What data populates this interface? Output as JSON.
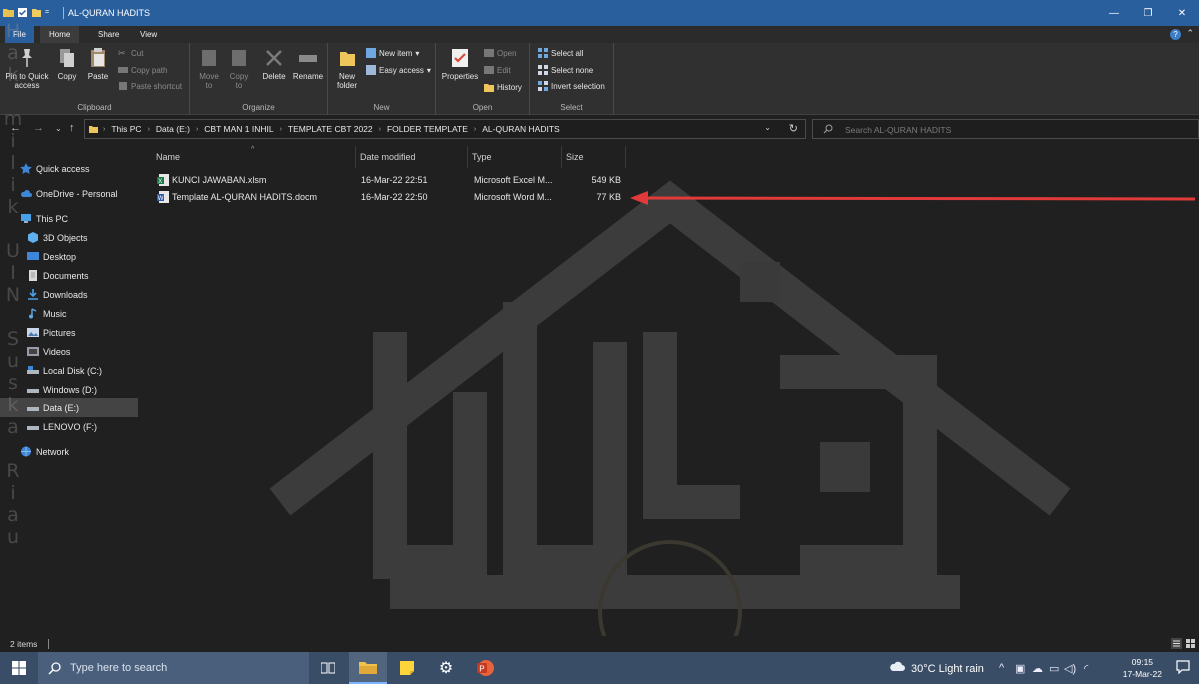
{
  "window": {
    "title": "AL-QURAN HADITS",
    "controls": {
      "minimize": "—",
      "restore": "❐",
      "close": "✕"
    }
  },
  "ribbon_tabs": [
    "File",
    "Home",
    "Share",
    "View"
  ],
  "ribbon": {
    "clipboard": {
      "label": "Clipboard",
      "pin": "Pin to Quick access",
      "copy": "Copy",
      "paste": "Paste",
      "cut": "Cut",
      "copy_path": "Copy path",
      "paste_shortcut": "Paste shortcut"
    },
    "organize": {
      "label": "Organize",
      "move_to": "Move to",
      "copy_to": "Copy to",
      "delete": "Delete",
      "rename": "Rename"
    },
    "new": {
      "label": "New",
      "new_folder": "New folder",
      "new_item": "New item",
      "easy_access": "Easy access"
    },
    "open": {
      "label": "Open",
      "properties": "Properties",
      "open": "Open",
      "edit": "Edit",
      "history": "History"
    },
    "select": {
      "label": "Select",
      "select_all": "Select all",
      "select_none": "Select none",
      "invert": "Invert selection"
    }
  },
  "breadcrumbs": [
    "This PC",
    "Data (E:)",
    "CBT MAN 1 INHIL",
    "TEMPLATE CBT 2022",
    "FOLDER TEMPLATE",
    "AL-QURAN HADITS"
  ],
  "search": {
    "placeholder": "Search AL-QURAN HADITS"
  },
  "sidebar": {
    "items": [
      {
        "label": "Quick access",
        "icon": "star-icon"
      },
      {
        "label": "OneDrive - Personal",
        "icon": "cloud-icon"
      },
      {
        "label": "This PC",
        "icon": "computer-icon"
      },
      {
        "label": "3D Objects",
        "icon": "cube-icon"
      },
      {
        "label": "Desktop",
        "icon": "desktop-icon"
      },
      {
        "label": "Documents",
        "icon": "documents-icon"
      },
      {
        "label": "Downloads",
        "icon": "downloads-icon"
      },
      {
        "label": "Music",
        "icon": "music-icon"
      },
      {
        "label": "Pictures",
        "icon": "pictures-icon"
      },
      {
        "label": "Videos",
        "icon": "videos-icon"
      },
      {
        "label": "Local Disk (C:)",
        "icon": "drive-icon"
      },
      {
        "label": "Windows (D:)",
        "icon": "drive-icon"
      },
      {
        "label": "Data (E:)",
        "icon": "drive-icon",
        "selected": true
      },
      {
        "label": "LENOVO (F:)",
        "icon": "drive-icon"
      },
      {
        "label": "Network",
        "icon": "network-icon"
      }
    ]
  },
  "columns": {
    "name": "Name",
    "date": "Date modified",
    "type": "Type",
    "size": "Size"
  },
  "files": [
    {
      "name": "KUNCI JAWABAN.xlsm",
      "date": "16-Mar-22 22:51",
      "type": "Microsoft Excel M...",
      "size": "549 KB",
      "icon": "excel-file-icon"
    },
    {
      "name": "Template AL-QURAN HADITS.docm",
      "date": "16-Mar-22 22:50",
      "type": "Microsoft Word M...",
      "size": "77 KB",
      "icon": "word-file-icon"
    }
  ],
  "status": {
    "count": "2 items"
  },
  "watermark": {
    "vertical_text": "Hak milik UIN Suska Riau"
  },
  "taskbar": {
    "search_placeholder": "Type here to search",
    "weather": "30°C  Light rain",
    "time": "09:15",
    "date": "17-Mar-22"
  },
  "colors": {
    "titlebar": "#2a5f9e",
    "background": "#202020",
    "ribbon": "#303030",
    "annotation_arrow": "#e03a3a",
    "taskbar": "#3a4d66"
  }
}
